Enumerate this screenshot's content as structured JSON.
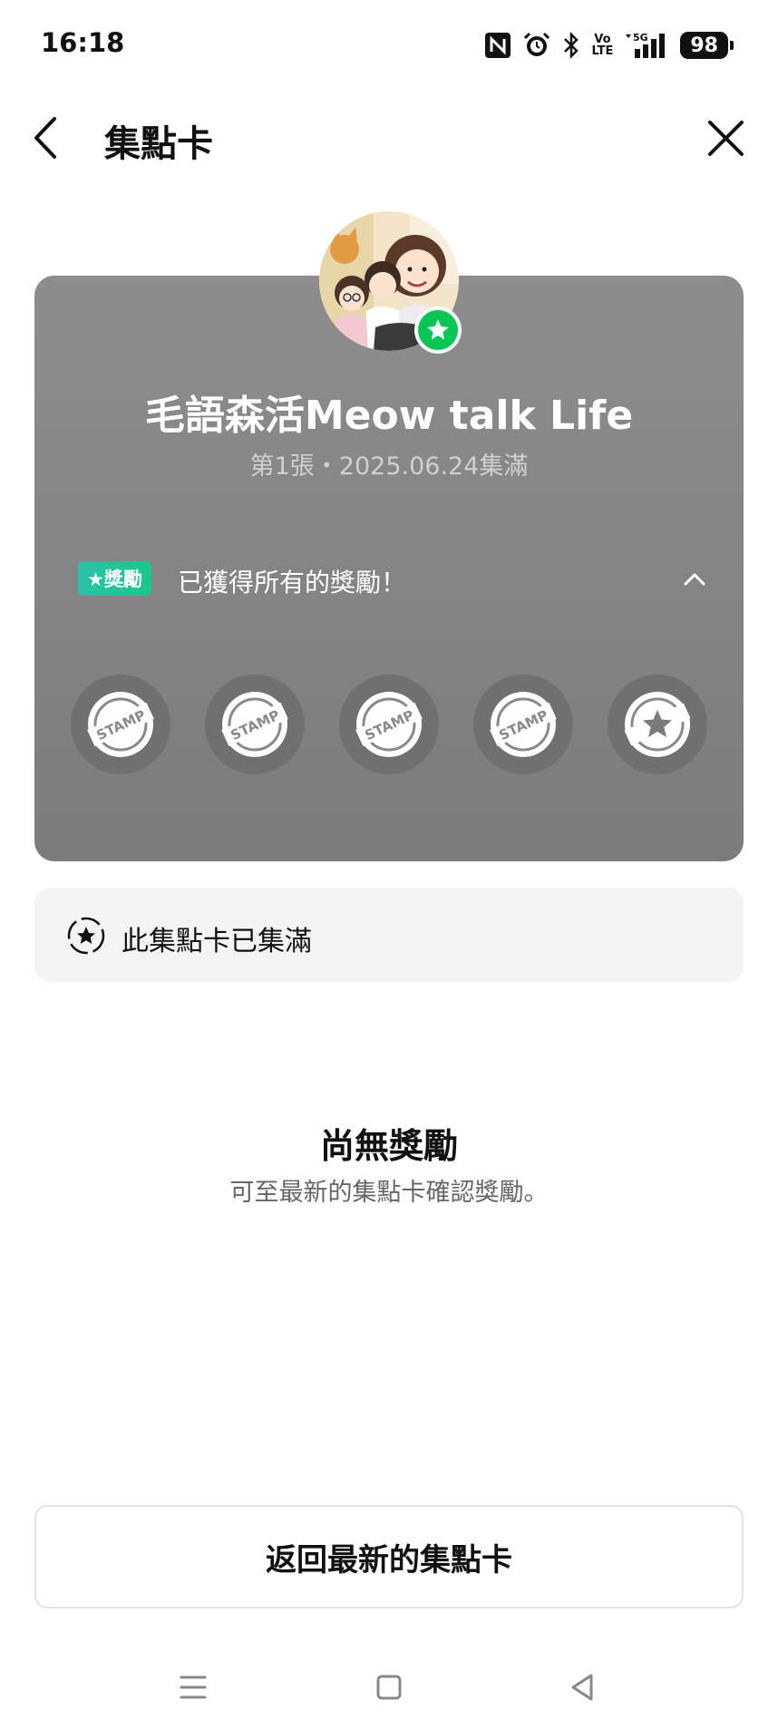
{
  "status_bar": {
    "time": "16:18",
    "icons": [
      "nfc-icon",
      "alarm-icon",
      "bluetooth-icon",
      "volte-icon",
      "signal-5g-icon",
      "battery-icon"
    ],
    "volte_top": "Vo",
    "volte_bottom": "LTE",
    "network": "5G",
    "battery": "98"
  },
  "header": {
    "title": "集點卡",
    "back_icon": "chevron-left-icon",
    "close_icon": "close-icon"
  },
  "card": {
    "title": "毛語森活Meow talk Life",
    "subtitle": "第1張・2025.06.24集滿",
    "reward_badge": "★獎勵",
    "reward_text": "已獲得所有的獎勵！",
    "stamps": [
      {
        "type": "stamp",
        "text": "STAMP"
      },
      {
        "type": "stamp",
        "text": "STAMP"
      },
      {
        "type": "stamp",
        "text": "STAMP"
      },
      {
        "type": "stamp",
        "text": "STAMP"
      },
      {
        "type": "reward-star"
      }
    ],
    "colors": {
      "card_bg": "#858585",
      "badge": "#18c98a",
      "avatar_badge": "#06c755"
    }
  },
  "info": {
    "text": "此集點卡已集滿"
  },
  "empty_state": {
    "title": "尚無獎勵",
    "description": "可至最新的集點卡確認獎勵。"
  },
  "actions": {
    "return_label": "返回最新的集點卡"
  },
  "nav_bar": {
    "icons": [
      "menu-icon",
      "home-square-icon",
      "back-triangle-icon"
    ]
  }
}
